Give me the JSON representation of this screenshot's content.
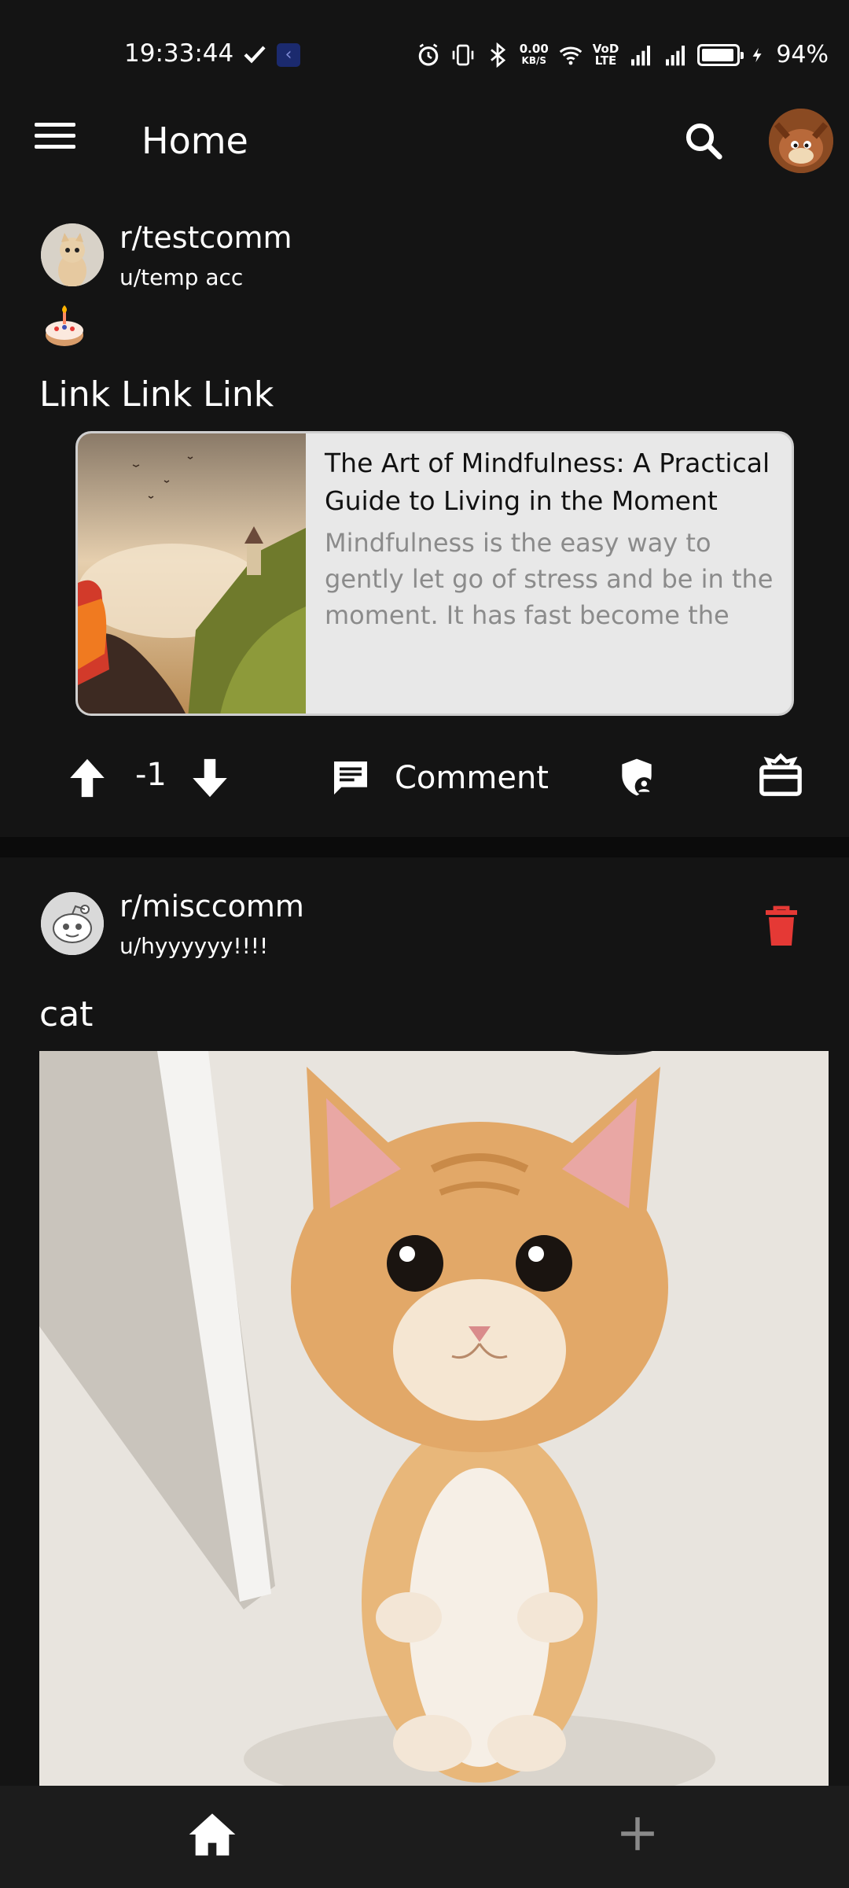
{
  "status_bar": {
    "time": "19:33:44",
    "net_speed_top": "0.00",
    "net_speed_bottom": "KB/S",
    "volte_top": "VoD",
    "volte_bottom": "LTE",
    "battery_percent": "94%",
    "battery_level": 0.94
  },
  "app_bar": {
    "title": "Home",
    "menu_icon": "menu-icon",
    "search_icon": "search-icon"
  },
  "posts": [
    {
      "subreddit": "r/testcomm",
      "author": "u/temp acc",
      "title": "Link Link Link",
      "link_card": {
        "title": "The Art of Mindfulness: A Practical Guide to Living in the Moment",
        "description": "Mindfulness is the easy way to gently let go of stress and be in the moment.  It has fast become the slo..."
      },
      "score": "-1",
      "comment_label": "Comment"
    },
    {
      "subreddit": "r/misccomm",
      "author": "u/hyyyyyy!!!!",
      "title": "cat"
    }
  ],
  "colors": {
    "background": "#0b0b0b",
    "surface": "#141414",
    "delete_red": "#e53935",
    "link_card_bg": "#e8e8e8"
  },
  "bottom_nav": {
    "home_icon": "home-icon",
    "add_icon": "plus-icon"
  }
}
